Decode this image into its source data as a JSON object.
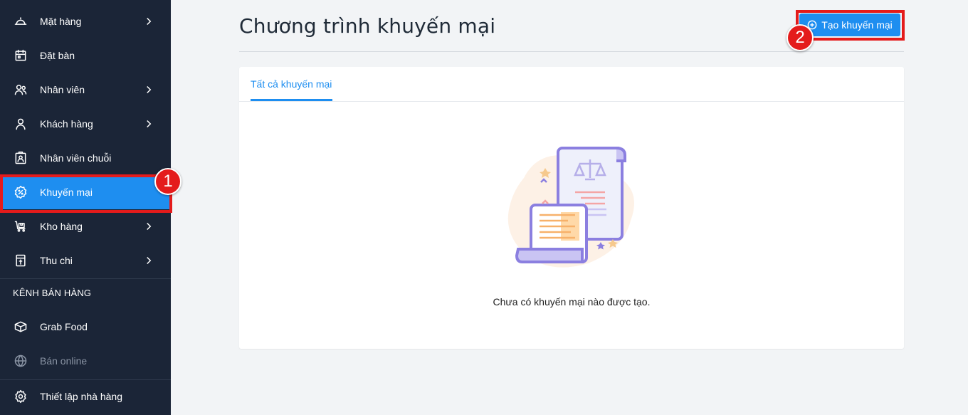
{
  "sidebar": {
    "items": [
      {
        "label": "Mặt hàng",
        "icon": "dish-cover-icon"
      },
      {
        "label": "Đặt bàn",
        "icon": "calendar-icon"
      },
      {
        "label": "Nhân viên",
        "icon": "users-icon"
      },
      {
        "label": "Khách hàng",
        "icon": "user-icon"
      },
      {
        "label": "Nhân viên chuỗi",
        "icon": "badge-icon"
      },
      {
        "label": "Khuyến mại",
        "icon": "promotion-icon"
      },
      {
        "label": "Kho hàng",
        "icon": "warehouse-icon"
      },
      {
        "label": "Thu chi",
        "icon": "cashbook-icon"
      }
    ],
    "channel_title": "KÊNH BÁN HÀNG",
    "channels": [
      {
        "label": "Grab Food",
        "icon": "box-icon"
      },
      {
        "label": "Bán online",
        "icon": "globe-icon"
      }
    ],
    "settings_label": "Thiết lập nhà hàng"
  },
  "annotations": {
    "step1": "1",
    "step2": "2",
    "color": "#e41b1b"
  },
  "main": {
    "title": "Chương trình khuyến mại",
    "create_button": "Tạo khuyến mại",
    "tab_all": "Tất cả khuyến mại",
    "empty_message": "Chưa có khuyến mại nào được tạo."
  },
  "colors": {
    "sidebar_bg": "#1b2537",
    "accent": "#1e8ef0"
  }
}
